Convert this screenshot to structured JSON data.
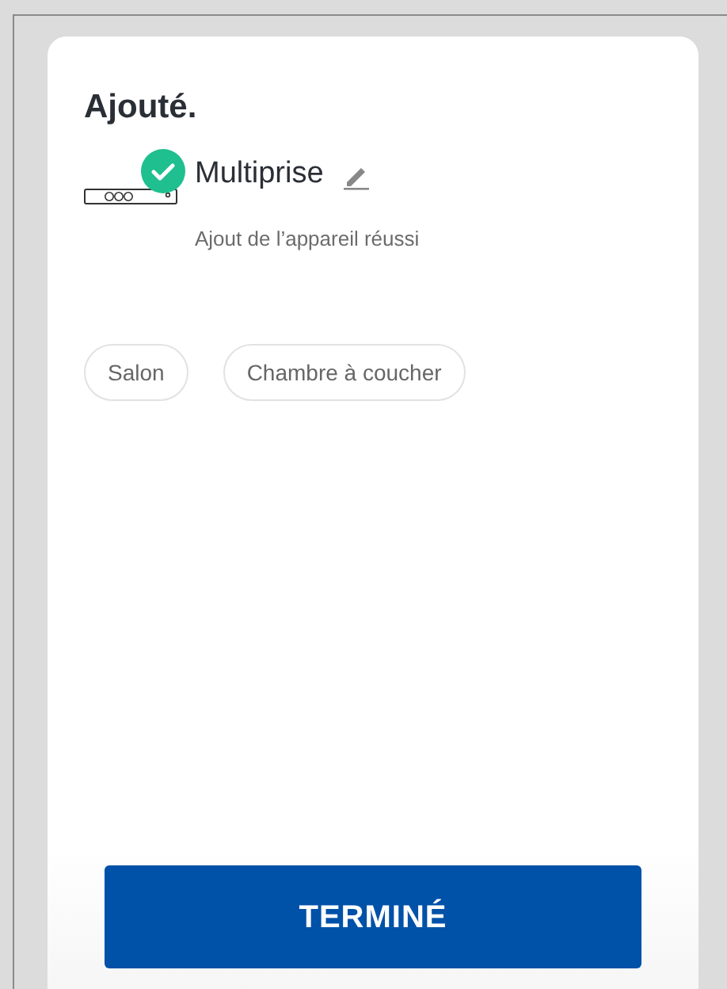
{
  "title": "Ajouté.",
  "device": {
    "name": "Multiprise",
    "added": true,
    "status": "Ajout de l’appareil réussi"
  },
  "rooms": [
    {
      "label": "Salon",
      "selected": false
    },
    {
      "label": "Chambre à coucher",
      "selected": false
    }
  ],
  "done_button": "TERMINÉ"
}
